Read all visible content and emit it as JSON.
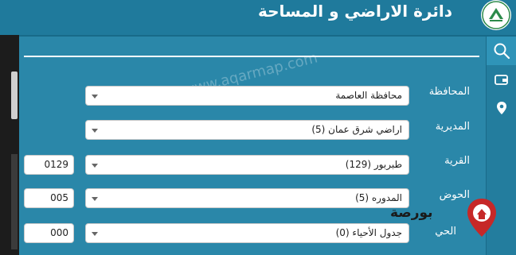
{
  "header": {
    "title": "دائرة الاراضي و المساحة"
  },
  "sidebar": {
    "icons": [
      "search-icon",
      "wallet-icon",
      "location-pin-icon"
    ]
  },
  "form": {
    "governorate": {
      "label": "المحافظة",
      "value": "محافظة العاصمة"
    },
    "directorate": {
      "label": "المديرية",
      "value": "اراضي شرق عمان (5)"
    },
    "village": {
      "label": "القرية",
      "value": "طبربور (129)",
      "code": "0129"
    },
    "basin": {
      "label": "الحوض",
      "value": "المدوره (5)",
      "code": "005"
    },
    "neighborhood": {
      "label": "الحي",
      "value": "جدول الأحياء (0)",
      "code": "000"
    }
  },
  "watermark": "© www.aqarmap.com",
  "badge": {
    "text": "بورصة"
  },
  "colors": {
    "header": "#1f7a9c",
    "panel": "#2a87a9",
    "sidebar": "#237d9e"
  }
}
